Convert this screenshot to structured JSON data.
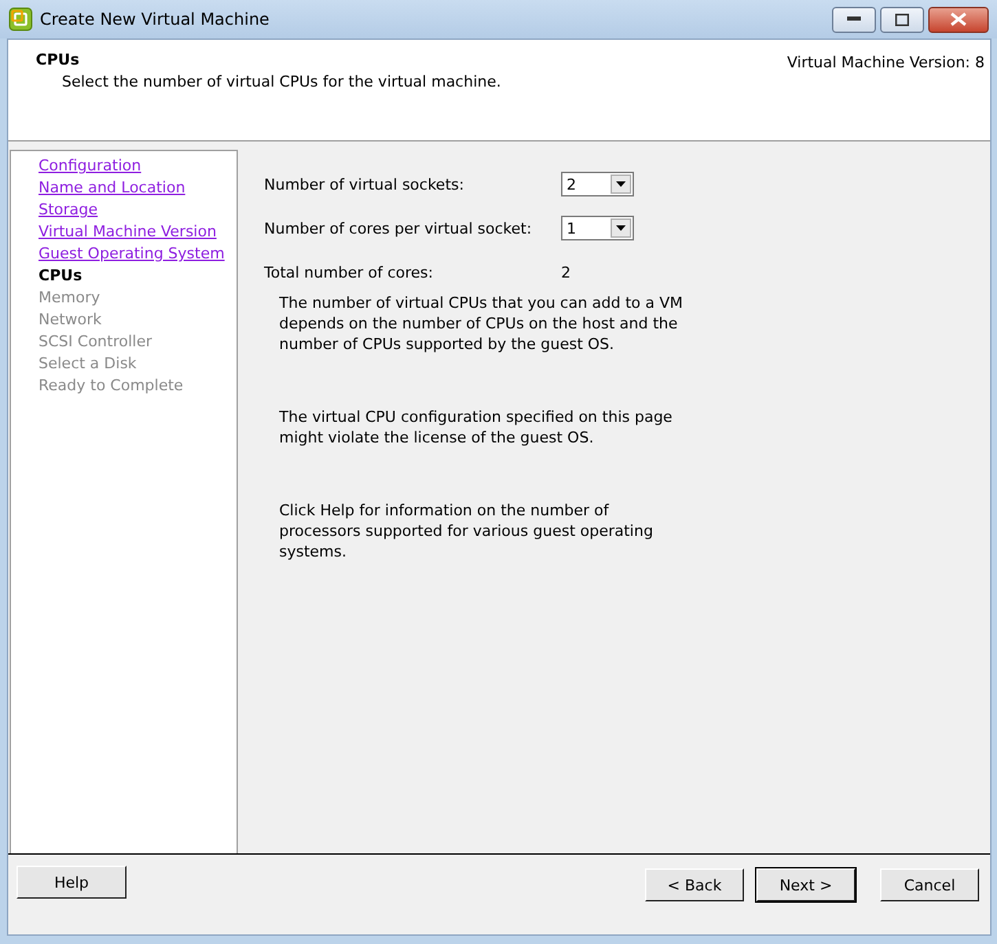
{
  "window": {
    "title": "Create New Virtual Machine"
  },
  "header": {
    "title": "CPUs",
    "subtitle": "Select the number of virtual CPUs for the virtual machine.",
    "version": "Virtual Machine Version: 8"
  },
  "steps": [
    {
      "label": "Configuration",
      "kind": "visited"
    },
    {
      "label": "Name and Location",
      "kind": "visited"
    },
    {
      "label": "Storage",
      "kind": "visited"
    },
    {
      "label": "Virtual Machine Version",
      "kind": "visited"
    },
    {
      "label": "Guest Operating System",
      "kind": "visited"
    },
    {
      "label": "CPUs",
      "kind": "current"
    },
    {
      "label": "Memory",
      "kind": "pending"
    },
    {
      "label": "Network",
      "kind": "pending"
    },
    {
      "label": "SCSI Controller",
      "kind": "pending"
    },
    {
      "label": "Select a Disk",
      "kind": "pending"
    },
    {
      "label": "Ready to Complete",
      "kind": "pending"
    }
  ],
  "fields": [
    {
      "label": "Number of virtual sockets:",
      "value": "2"
    },
    {
      "label": "Number of cores per virtual socket:",
      "value": "1"
    }
  ],
  "total": {
    "label": "Total number of cores:",
    "value": "2"
  },
  "notes": [
    "The number of virtual CPUs that you can add to a VM depends on the number of CPUs on the host and the number of CPUs supported by the guest OS.",
    "The virtual CPU configuration specified on this page might violate the license of the guest OS.",
    "Click Help for information on the number of processors supported for various guest operating systems."
  ],
  "buttons": {
    "help": "Help",
    "back": "< Back",
    "next": "Next >",
    "cancel": "Cancel"
  }
}
